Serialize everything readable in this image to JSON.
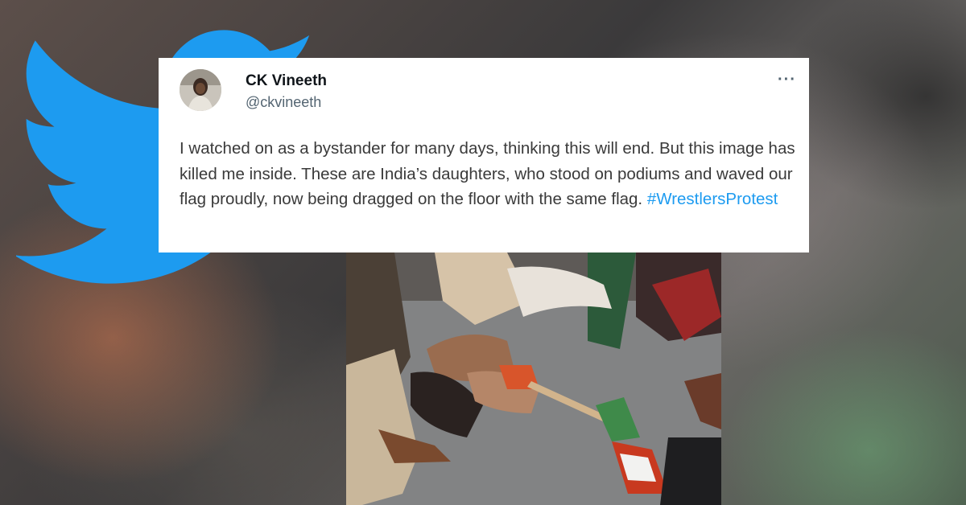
{
  "tweet": {
    "author_name": "CK Vineeth",
    "author_handle": "@ckvineeth",
    "more_icon": "more-horizontal-icon",
    "body": "I watched on as a bystander for many days, thinking this will end. But this image has killed me inside. These are India’s daughters, who stood on podiums and waved our flag proudly, now being dragged on the floor with the same flag.",
    "hashtag": "#WrestlersProtest"
  },
  "icons": {
    "logo": "twitter-bird-icon"
  },
  "colors": {
    "twitter_blue": "#1d9bf0",
    "card_background": "#ffffff",
    "name_text": "#0f1419",
    "handle_text": "#536471"
  }
}
